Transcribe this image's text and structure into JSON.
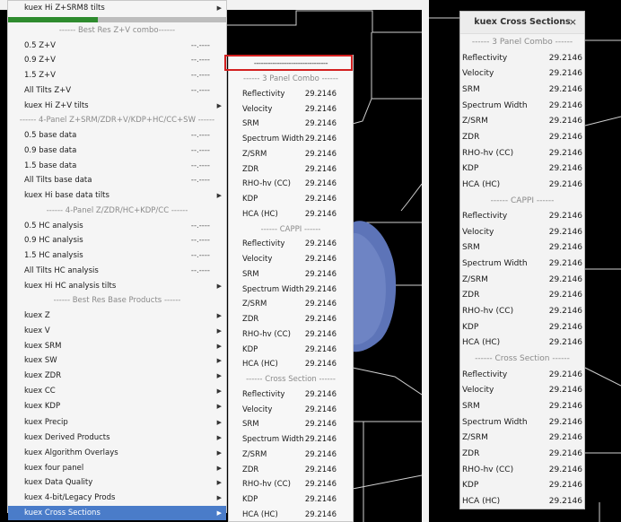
{
  "main_menu": {
    "items": [
      {
        "type": "item",
        "label": "kuex Hi Z+SRM8 tilts",
        "value": "",
        "submenu": true
      },
      {
        "type": "colorbar"
      },
      {
        "type": "header",
        "label": "------ Best Res Z+V combo------"
      },
      {
        "type": "item",
        "label": "0.5 Z+V",
        "value": "--.----",
        "submenu": false
      },
      {
        "type": "item",
        "label": "0.9 Z+V",
        "value": "--.----",
        "submenu": false
      },
      {
        "type": "item",
        "label": "1.5 Z+V",
        "value": "--.----",
        "submenu": false
      },
      {
        "type": "item",
        "label": "All Tilts Z+V",
        "value": "--.----",
        "submenu": false
      },
      {
        "type": "item",
        "label": "kuex Hi Z+V tilts",
        "value": "",
        "submenu": true
      },
      {
        "type": "header",
        "label": "------ 4-Panel Z+SRM/ZDR+V/KDP+HC/CC+SW ------"
      },
      {
        "type": "item",
        "label": "0.5 base data",
        "value": "--.----",
        "submenu": false
      },
      {
        "type": "item",
        "label": "0.9 base data",
        "value": "--.----",
        "submenu": false
      },
      {
        "type": "item",
        "label": "1.5 base data",
        "value": "--.----",
        "submenu": false
      },
      {
        "type": "item",
        "label": "All Tilts base data",
        "value": "--.----",
        "submenu": false
      },
      {
        "type": "item",
        "label": "kuex Hi base data tilts",
        "value": "",
        "submenu": true
      },
      {
        "type": "header",
        "label": "------ 4-Panel Z/ZDR/HC+KDP/CC ------"
      },
      {
        "type": "item",
        "label": "0.5 HC analysis",
        "value": "--.----",
        "submenu": false
      },
      {
        "type": "item",
        "label": "0.9 HC analysis",
        "value": "--.----",
        "submenu": false
      },
      {
        "type": "item",
        "label": "1.5 HC analysis",
        "value": "--.----",
        "submenu": false
      },
      {
        "type": "item",
        "label": "All Tilts HC analysis",
        "value": "--.----",
        "submenu": false
      },
      {
        "type": "item",
        "label": "kuex Hi HC analysis tilts",
        "value": "",
        "submenu": true
      },
      {
        "type": "header",
        "label": "------ Best Res Base Products ------"
      },
      {
        "type": "item",
        "label": "kuex Z",
        "value": "",
        "submenu": true
      },
      {
        "type": "item",
        "label": "kuex V",
        "value": "",
        "submenu": true
      },
      {
        "type": "item",
        "label": "kuex SRM",
        "value": "",
        "submenu": true
      },
      {
        "type": "item",
        "label": "kuex SW",
        "value": "",
        "submenu": true
      },
      {
        "type": "item",
        "label": "kuex ZDR",
        "value": "",
        "submenu": true
      },
      {
        "type": "item",
        "label": "kuex CC",
        "value": "",
        "submenu": true
      },
      {
        "type": "item",
        "label": "kuex KDP",
        "value": "",
        "submenu": true
      },
      {
        "type": "spacer"
      },
      {
        "type": "item",
        "label": "kuex Precip",
        "value": "",
        "submenu": true
      },
      {
        "type": "item",
        "label": "kuex Derived Products",
        "value": "",
        "submenu": true
      },
      {
        "type": "item",
        "label": "kuex Algorithm Overlays",
        "value": "",
        "submenu": true
      },
      {
        "type": "item",
        "label": "kuex four panel",
        "value": "",
        "submenu": true
      },
      {
        "type": "item",
        "label": "kuex Data Quality",
        "value": "",
        "submenu": true
      },
      {
        "type": "item",
        "label": "kuex 4-bit/Legacy Prods",
        "value": "",
        "submenu": true
      },
      {
        "type": "item",
        "label": "kuex Cross Sections",
        "value": "",
        "submenu": true,
        "selected": true
      }
    ]
  },
  "sub_menu": {
    "tearoff": "--------------------------------",
    "items": [
      {
        "type": "header",
        "label": "------ 3 Panel Combo ------"
      },
      {
        "type": "item",
        "label": "Reflectivity",
        "value": "29.2146"
      },
      {
        "type": "item",
        "label": "Velocity",
        "value": "29.2146"
      },
      {
        "type": "item",
        "label": "SRM",
        "value": "29.2146"
      },
      {
        "type": "item",
        "label": "Spectrum Width",
        "value": "29.2146"
      },
      {
        "type": "item",
        "label": "Z/SRM",
        "value": "29.2146"
      },
      {
        "type": "item",
        "label": "ZDR",
        "value": "29.2146"
      },
      {
        "type": "item",
        "label": "RHO-hv (CC)",
        "value": "29.2146"
      },
      {
        "type": "item",
        "label": "KDP",
        "value": "29.2146"
      },
      {
        "type": "item",
        "label": "HCA (HC)",
        "value": "29.2146"
      },
      {
        "type": "header",
        "label": "------ CAPPI ------"
      },
      {
        "type": "item",
        "label": "Reflectivity",
        "value": "29.2146"
      },
      {
        "type": "item",
        "label": "Velocity",
        "value": "29.2146"
      },
      {
        "type": "item",
        "label": "SRM",
        "value": "29.2146"
      },
      {
        "type": "item",
        "label": "Spectrum Width",
        "value": "29.2146"
      },
      {
        "type": "item",
        "label": "Z/SRM",
        "value": "29.2146"
      },
      {
        "type": "item",
        "label": "ZDR",
        "value": "29.2146"
      },
      {
        "type": "item",
        "label": "RHO-hv (CC)",
        "value": "29.2146"
      },
      {
        "type": "item",
        "label": "KDP",
        "value": "29.2146"
      },
      {
        "type": "item",
        "label": "HCA (HC)",
        "value": "29.2146"
      },
      {
        "type": "header",
        "label": "------ Cross Section ------"
      },
      {
        "type": "item",
        "label": "Reflectivity",
        "value": "29.2146"
      },
      {
        "type": "item",
        "label": "Velocity",
        "value": "29.2146"
      },
      {
        "type": "item",
        "label": "SRM",
        "value": "29.2146"
      },
      {
        "type": "item",
        "label": "Spectrum Width",
        "value": "29.2146"
      },
      {
        "type": "item",
        "label": "Z/SRM",
        "value": "29.2146"
      },
      {
        "type": "item",
        "label": "ZDR",
        "value": "29.2146"
      },
      {
        "type": "item",
        "label": "RHO-hv (CC)",
        "value": "29.2146"
      },
      {
        "type": "item",
        "label": "KDP",
        "value": "29.2146"
      },
      {
        "type": "item",
        "label": "HCA (HC)",
        "value": "29.2146"
      }
    ]
  },
  "float_window": {
    "title": "kuex Cross Sections",
    "close": "×",
    "items": [
      {
        "type": "header",
        "label": "------ 3 Panel Combo ------"
      },
      {
        "type": "item",
        "label": "Reflectivity",
        "value": "29.2146"
      },
      {
        "type": "item",
        "label": "Velocity",
        "value": "29.2146"
      },
      {
        "type": "item",
        "label": "SRM",
        "value": "29.2146"
      },
      {
        "type": "item",
        "label": "Spectrum Width",
        "value": "29.2146"
      },
      {
        "type": "item",
        "label": "Z/SRM",
        "value": "29.2146"
      },
      {
        "type": "item",
        "label": "ZDR",
        "value": "29.2146"
      },
      {
        "type": "item",
        "label": "RHO-hv (CC)",
        "value": "29.2146"
      },
      {
        "type": "item",
        "label": "KDP",
        "value": "29.2146"
      },
      {
        "type": "item",
        "label": "HCA (HC)",
        "value": "29.2146"
      },
      {
        "type": "header",
        "label": "------ CAPPI ------"
      },
      {
        "type": "item",
        "label": "Reflectivity",
        "value": "29.2146"
      },
      {
        "type": "item",
        "label": "Velocity",
        "value": "29.2146"
      },
      {
        "type": "item",
        "label": "SRM",
        "value": "29.2146"
      },
      {
        "type": "item",
        "label": "Spectrum Width",
        "value": "29.2146"
      },
      {
        "type": "item",
        "label": "Z/SRM",
        "value": "29.2146"
      },
      {
        "type": "item",
        "label": "ZDR",
        "value": "29.2146"
      },
      {
        "type": "item",
        "label": "RHO-hv (CC)",
        "value": "29.2146"
      },
      {
        "type": "item",
        "label": "KDP",
        "value": "29.2146"
      },
      {
        "type": "item",
        "label": "HCA (HC)",
        "value": "29.2146"
      },
      {
        "type": "header",
        "label": "------ Cross Section ------"
      },
      {
        "type": "item",
        "label": "Reflectivity",
        "value": "29.2146"
      },
      {
        "type": "item",
        "label": "Velocity",
        "value": "29.2146"
      },
      {
        "type": "item",
        "label": "SRM",
        "value": "29.2146"
      },
      {
        "type": "item",
        "label": "Spectrum Width",
        "value": "29.2146"
      },
      {
        "type": "item",
        "label": "Z/SRM",
        "value": "29.2146"
      },
      {
        "type": "item",
        "label": "ZDR",
        "value": "29.2146"
      },
      {
        "type": "item",
        "label": "RHO-hv (CC)",
        "value": "29.2146"
      },
      {
        "type": "item",
        "label": "KDP",
        "value": "29.2146"
      },
      {
        "type": "item",
        "label": "HCA (HC)",
        "value": "29.2146"
      }
    ]
  },
  "colors": {
    "selected": "#4a7cc9",
    "highlight_box": "#d32020",
    "radar_echo": "#5d74b8"
  }
}
